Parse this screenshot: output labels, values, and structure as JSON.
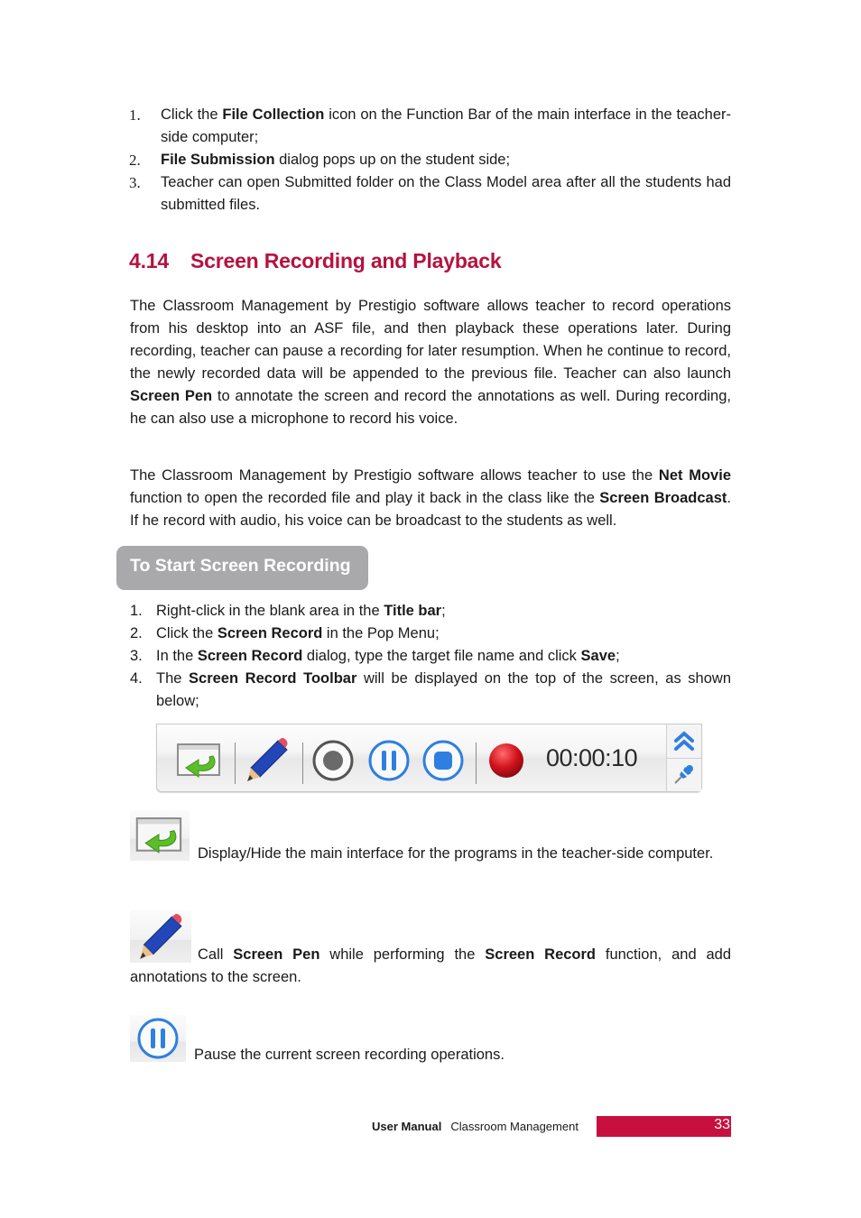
{
  "top_list": [
    {
      "num": "1.",
      "parts": [
        [
          "Click the ",
          false
        ],
        [
          "File Collection",
          true
        ],
        [
          " icon on the Function Bar of the main interface in the teacher-side computer;",
          false
        ]
      ]
    },
    {
      "num": "2.",
      "parts": [
        [
          "File Submission",
          true
        ],
        [
          " dialog pops up on the student side;",
          false
        ]
      ]
    },
    {
      "num": "3.",
      "parts": [
        [
          "Teacher can open Submitted folder on the Class Model area after all the students had submitted files.",
          false
        ]
      ]
    }
  ],
  "section": {
    "number": "4.14",
    "title": "Screen Recording and Playback"
  },
  "paragraphs": [
    [
      [
        "The Classroom Management by Prestigio software allows teacher to record operations from his desktop into an ASF file, and then playback these operations later. During recording, teacher can pause a recording for later resumption. When he continue to record, the newly recorded data will be appended to the previous file. Teacher can also launch ",
        false
      ],
      [
        "Screen Pen",
        true
      ],
      [
        " to annotate the screen and record the annotations as well. During recording, he can also use a microphone to record his voice.",
        false
      ]
    ],
    [
      [
        "The Classroom Management by Prestigio software allows teacher to use the ",
        false
      ],
      [
        "Net Movie",
        true
      ],
      [
        " function to open the recorded file and play it back in the class like the ",
        false
      ],
      [
        "Screen Broadcast",
        true
      ],
      [
        ". If he record with audio, his voice can be broadcast to the students as well.",
        false
      ]
    ]
  ],
  "subheading": "To Start Screen Recording",
  "steps": [
    {
      "num": "1.",
      "parts": [
        [
          "Right-click in the blank area in the ",
          false
        ],
        [
          "Title bar",
          true
        ],
        [
          ";",
          false
        ]
      ]
    },
    {
      "num": "2.",
      "parts": [
        [
          "Click the ",
          false
        ],
        [
          "Screen Record",
          true
        ],
        [
          " in the Pop Menu;",
          false
        ]
      ]
    },
    {
      "num": "3.",
      "parts": [
        [
          "In the ",
          false
        ],
        [
          "Screen Record",
          true
        ],
        [
          " dialog, type the target file name and click ",
          false
        ],
        [
          "Save",
          true
        ],
        [
          ";",
          false
        ]
      ]
    },
    {
      "num": "4.",
      "parts": [
        [
          "The ",
          false
        ],
        [
          "Screen Record Toolbar",
          true
        ],
        [
          " will be displayed on the top of the screen, as shown below;",
          false
        ]
      ]
    }
  ],
  "toolbar": {
    "timer": "00:00:10",
    "buttons": [
      "display-hide-interface-icon",
      "screen-pen-icon",
      "record-icon",
      "pause-icon",
      "stop-icon",
      "recording-indicator-icon",
      "collapse-up-icon",
      "pin-icon"
    ],
    "colors": {
      "accent_blue": "#2f7fe0",
      "record_red": "#d0121b",
      "pen_blue": "#2346b8",
      "arrow_green": "#5cbf2a"
    }
  },
  "descriptions": [
    {
      "icon": "display-hide-interface-icon",
      "parts": [
        [
          "Display/Hide the main interface for the programs in the teacher-side computer.",
          false
        ]
      ]
    },
    {
      "icon": "screen-pen-icon",
      "parts": [
        [
          "Call ",
          false
        ],
        [
          "Screen Pen",
          true
        ],
        [
          " while performing the ",
          false
        ],
        [
          "Screen Record",
          true
        ],
        [
          " function, and add annotations to the screen.",
          false
        ]
      ]
    },
    {
      "icon": "pause-icon",
      "parts": [
        [
          "Pause the current screen recording operations.",
          false
        ]
      ]
    }
  ],
  "footer": {
    "manual": "User Manual",
    "product": "Classroom Management",
    "page": "33",
    "accent_color": "#c8103e"
  }
}
